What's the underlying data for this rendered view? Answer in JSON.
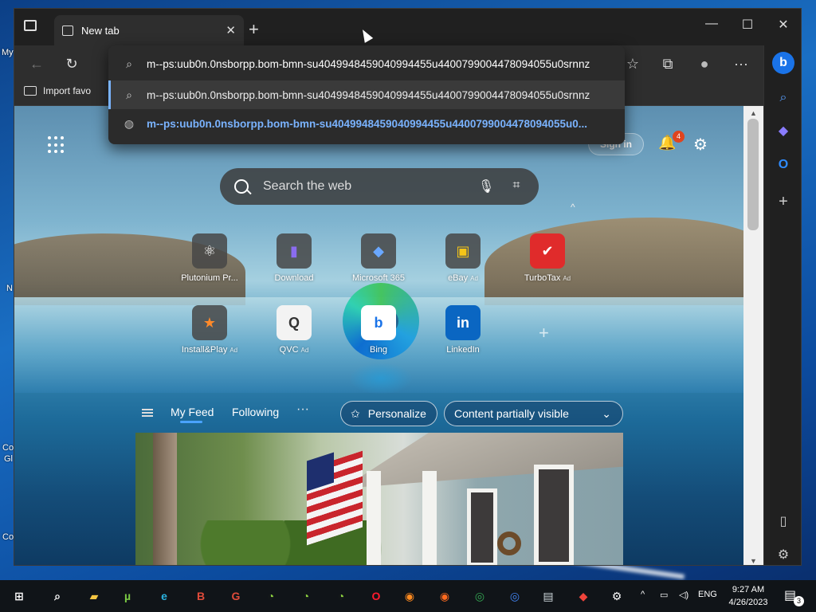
{
  "desktop": {
    "fragments": [
      "My",
      "N",
      "Co",
      "Gl",
      "Co"
    ]
  },
  "browser": {
    "tab": {
      "title": "New tab",
      "close_glyph": "✕"
    },
    "window_controls": {
      "minimize": "—",
      "maximize": "☐",
      "close": "✕"
    },
    "favorites_bar": {
      "import_label": "Import favo"
    },
    "address_bar": {
      "value": "m--ps:uub0n.0nsborpp.bom-bmn-su4049948459040994455u4400799004478094055u0srnnz",
      "suggestions": [
        {
          "icon": "search-icon",
          "text": "m--ps:uub0n.0nsborpp.bom-bmn-su4049948459040994455u4400799004478094055u0srnnz"
        },
        {
          "icon": "globe-icon",
          "text": "m--ps:uub0n.0nsborpp.bom-bmn-su4049948459040994455u4400799004478094055u0..."
        }
      ]
    }
  },
  "newtab": {
    "signin_label": "Sign in",
    "notification_count": "4",
    "search_placeholder": "Search the web",
    "tiles": [
      {
        "label": "Plutonium Pr...",
        "ad": "",
        "glyph": "⚛",
        "color": "#ffffff"
      },
      {
        "label": "Download",
        "ad": "",
        "glyph": "▮",
        "color": "#8a6cf0"
      },
      {
        "label": "Microsoft 365",
        "ad": "",
        "glyph": "◆",
        "color": "#6aa8ff"
      },
      {
        "label": "eBay",
        "ad": "Ad",
        "glyph": "▣",
        "color": "#f5c518"
      },
      {
        "label": "TurboTax",
        "ad": "Ad",
        "glyph": "✔",
        "color": "#e02b2b"
      },
      {
        "label": "Install&Play",
        "ad": "Ad",
        "glyph": "★",
        "color": "#ff8a2a"
      },
      {
        "label": "QVC",
        "ad": "Ad",
        "glyph": "Q",
        "color": "#333333"
      },
      {
        "label": "Bing",
        "ad": "",
        "glyph": "b",
        "color": "#1a73e8"
      },
      {
        "label": "LinkedIn",
        "ad": "",
        "glyph": "in",
        "color": "#0a66c2"
      }
    ],
    "feed": {
      "tabs": [
        "My Feed",
        "Following"
      ],
      "more": "···",
      "personalize_label": "Personalize",
      "visibility_label": "Content partially visible"
    }
  },
  "taskbar": {
    "language": "ENG",
    "time": "9:27 AM",
    "date": "4/26/2023",
    "notification_count": "3",
    "icons": [
      {
        "name": "start-icon",
        "glyph": "⊞",
        "color": "#ffffff"
      },
      {
        "name": "search-icon",
        "glyph": "⌕",
        "color": "#ffffff"
      },
      {
        "name": "file-explorer-icon",
        "glyph": "▰",
        "color": "#f5c542"
      },
      {
        "name": "utorrent-icon",
        "glyph": "µ",
        "color": "#7ac943"
      },
      {
        "name": "edge-icon",
        "glyph": "e",
        "color": "#2bb3e0"
      },
      {
        "name": "chrome-b-icon",
        "glyph": "B",
        "color": "#e04b3a"
      },
      {
        "name": "chrome-g-icon",
        "glyph": "G",
        "color": "#e04b3a"
      },
      {
        "name": "app-green-1-icon",
        "glyph": "◔",
        "color": "#8ccf3f"
      },
      {
        "name": "app-green-2-icon",
        "glyph": "◔",
        "color": "#8ccf3f"
      },
      {
        "name": "app-green-3-icon",
        "glyph": "◔",
        "color": "#8ccf3f"
      },
      {
        "name": "opera-icon",
        "glyph": "O",
        "color": "#ff1b2d"
      },
      {
        "name": "firefox-icon",
        "glyph": "◉",
        "color": "#ff8a1f"
      },
      {
        "name": "firefox-alt-icon",
        "glyph": "◉",
        "color": "#ff6a1f"
      },
      {
        "name": "chrome-icon",
        "glyph": "◎",
        "color": "#34a853"
      },
      {
        "name": "chrome-alt-icon",
        "glyph": "◎",
        "color": "#4285f4"
      },
      {
        "name": "image-viewer-icon",
        "glyph": "▤",
        "color": "#cfd8dc"
      },
      {
        "name": "anydesk-icon",
        "glyph": "◆",
        "color": "#ef443b"
      },
      {
        "name": "settings-icon",
        "glyph": "⚙",
        "color": "#ffffff"
      }
    ]
  }
}
